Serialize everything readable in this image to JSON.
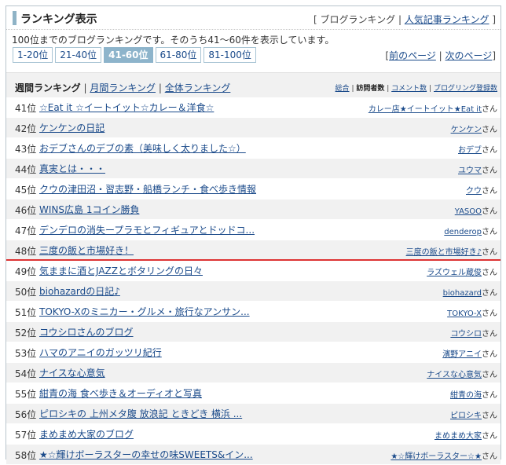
{
  "header": {
    "title": "ランキング表示",
    "bracket_open": "[",
    "blog_ranking": "ブログランキング",
    "sep": "|",
    "popular_articles": "人気記事ランキング",
    "bracket_close": "]"
  },
  "description": "100位までのブログランキングです。そのうち41〜60件を表示しています。",
  "pager": {
    "pages": [
      "1-20位",
      "21-40位",
      "41-60位",
      "61-80位",
      "81-100位"
    ],
    "active": "41-60位",
    "prev": "前のページ",
    "next": "次のページ",
    "bracket_open": "[",
    "sep": "|",
    "bracket_close": "]"
  },
  "tabs": {
    "weekly": "週間ランキング",
    "monthly": "月間ランキング",
    "all": "全体ランキング",
    "sep": "|"
  },
  "sorts": {
    "total": "総合",
    "visitors": "訪問者数",
    "comments": "コメント数",
    "registrations": "ブログリング登録数",
    "sep": "|"
  },
  "suffix": "さん",
  "rows": [
    {
      "rank": "41位",
      "title": "☆Eat it ☆イートイット☆カレー＆洋食☆",
      "author": "カレー店★イートイット★Eat it"
    },
    {
      "rank": "42位",
      "title": "ケンケンの日記",
      "author": "ケンケン"
    },
    {
      "rank": "43位",
      "title": "おデブさんのデブの素（美味しく太りました☆）",
      "author": "おデブ"
    },
    {
      "rank": "44位",
      "title": "真実とは・・・",
      "author": "ユウマ"
    },
    {
      "rank": "45位",
      "title": "クウの津田沼・習志野・船橋ランチ・食べ歩き情報",
      "author": "クウ"
    },
    {
      "rank": "46位",
      "title": "WINS広島 1コイン勝負",
      "author": "YASOO"
    },
    {
      "rank": "47位",
      "title": "デンデロの消失ープラモとフィギュアとドッドコ...",
      "author": "denderop"
    },
    {
      "rank": "48位",
      "title": "三度の飯と市場好き！",
      "author": "三度の飯と市場好き♪"
    },
    {
      "rank": "49位",
      "title": "気ままに酒とJAZZとボタリングの日々",
      "author": "ラズウェル蔵俊"
    },
    {
      "rank": "50位",
      "title": "biohazardの日記♪",
      "author": "biohazard"
    },
    {
      "rank": "51位",
      "title": "TOKYO-Xのミニカー・グルメ・旅行なアンサン...",
      "author": "TOKYO-X"
    },
    {
      "rank": "52位",
      "title": "コウシロさんのブログ",
      "author": "コウシロ"
    },
    {
      "rank": "53位",
      "title": "ハマのアニイのガッツリ紀行",
      "author": "濱野アニイ"
    },
    {
      "rank": "54位",
      "title": "ナイスな心意気",
      "author": "ナイスな心意気"
    },
    {
      "rank": "55位",
      "title": "紺青の海 食べ歩き＆オーディオと写真",
      "author": "紺青の海"
    },
    {
      "rank": "56位",
      "title": "ピロシキの 上州メタ腹 放浪記 ときどき 横浜 ...",
      "author": "ピロシキ"
    },
    {
      "rank": "57位",
      "title": "まめまめ大家のブログ",
      "author": "まめまめ大家"
    },
    {
      "rank": "58位",
      "title": "★☆輝けボーラスターの幸せの味SWEETS&イン...",
      "author": "★☆輝けボーラスター☆★"
    }
  ],
  "colors": {
    "accent": "#8db4cb",
    "link": "#1a4a8a",
    "highlight_line": "#dd3333",
    "row_alt": "#f1f1f1"
  }
}
